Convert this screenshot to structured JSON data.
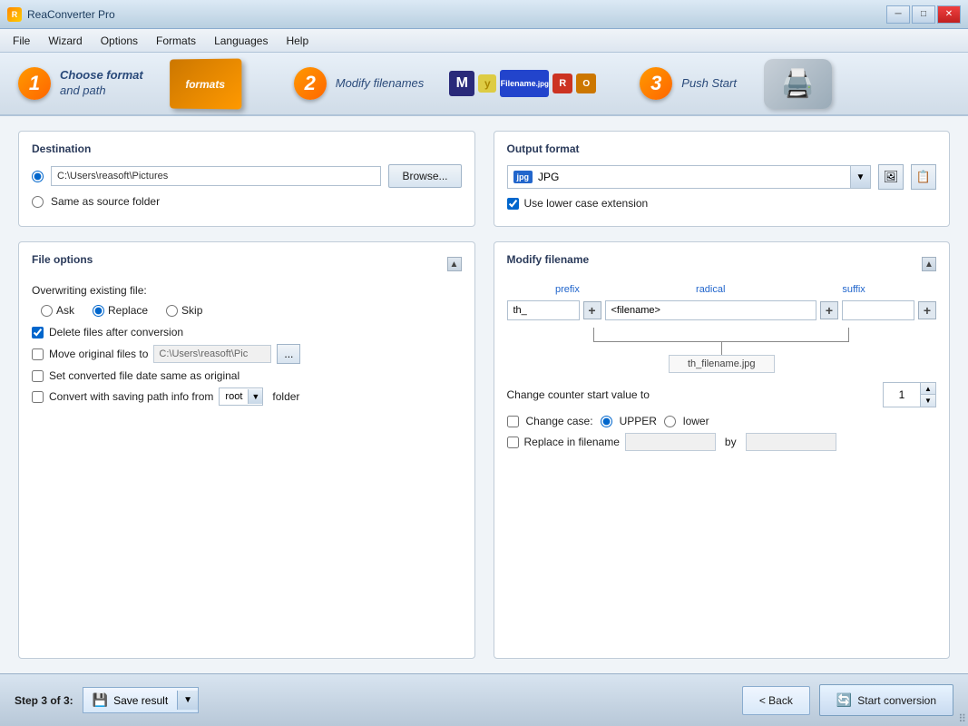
{
  "titleBar": {
    "icon": "RC",
    "title": "ReaConverter Pro",
    "minimizeLabel": "─",
    "maximizeLabel": "□",
    "closeLabel": "✕"
  },
  "menuBar": {
    "items": [
      "File",
      "Wizard",
      "Options",
      "Formats",
      "Languages",
      "Help"
    ]
  },
  "stepBanner": {
    "step1": {
      "number": "1",
      "line1": "Choose format",
      "line2": "and path"
    },
    "step2": {
      "number": "2",
      "label": "Modify filenames"
    },
    "step3": {
      "number": "3",
      "label": "Push Start"
    }
  },
  "destination": {
    "sectionTitle": "Destination",
    "radioPath": "C:\\Users\\reasoft\\Pictures",
    "radioSameLabel": "Same as source folder",
    "browseLabel": "Browse..."
  },
  "outputFormat": {
    "sectionTitle": "Output format",
    "formatName": "JPG",
    "useLowerCaseLabel": "Use lower case extension"
  },
  "fileOptions": {
    "sectionTitle": "File options",
    "overwriteLabel": "Overwriting existing file:",
    "radioAsk": "Ask",
    "radioReplace": "Replace",
    "radioSkip": "Skip",
    "deleteFilesLabel": "Delete files after conversion",
    "moveOriginalLabel": "Move original files to",
    "moveInputValue": "C:\\Users\\reasoft\\Pic",
    "ellipsisLabel": "...",
    "setDateLabel": "Set converted file date same as original",
    "convertSavingLabel": "Convert with saving path info from",
    "comboRoot": "root",
    "folderLabel": "folder"
  },
  "modifyFilename": {
    "sectionTitle": "Modify filename",
    "colPrefix": "prefix",
    "colRadical": "radical",
    "colSuffix": "suffix",
    "prefixValue": "th_",
    "radicalValue": "<filename>",
    "suffixValue": "",
    "previewValue": "th_filename.jpg",
    "counterLabel": "Change counter start value to",
    "counterValue": "1",
    "changeCaseLabel": "Change case:",
    "upperLabel": "UPPER",
    "lowerLabel": "lower",
    "replaceLabel": "Replace in filename",
    "byLabel": "by"
  },
  "bottomBar": {
    "stepLabel": "Step 3 of 3:",
    "saveResultLabel": "Save result",
    "backLabel": "< Back",
    "startLabel": "Start conversion"
  }
}
